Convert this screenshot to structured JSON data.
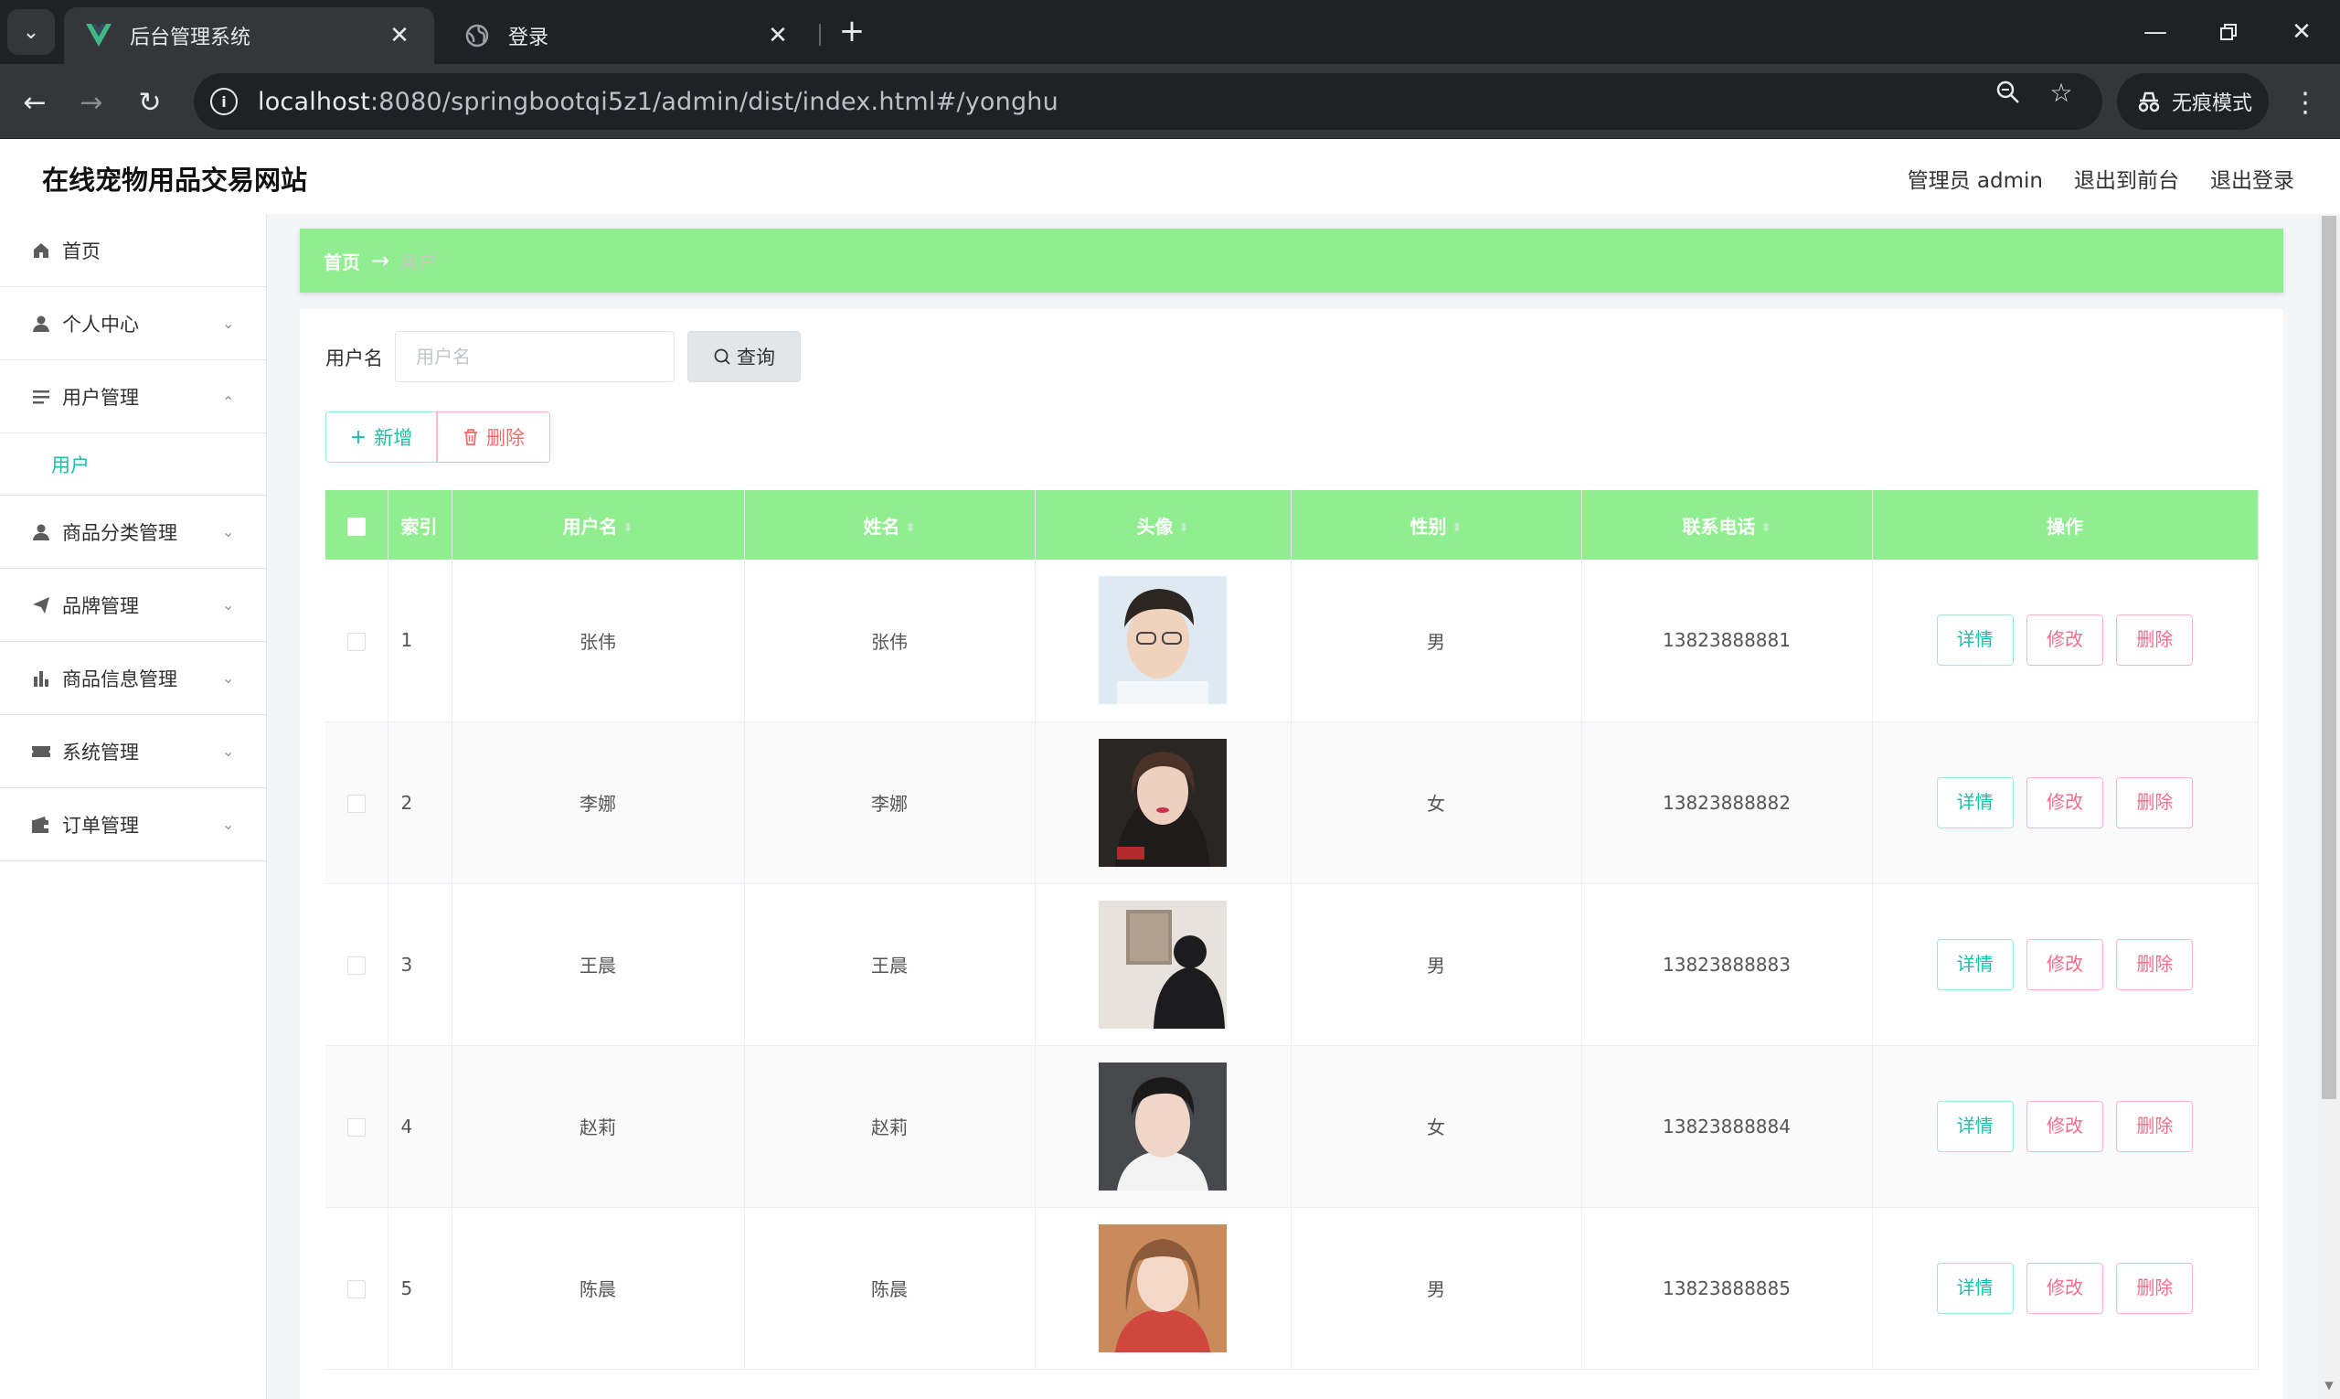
{
  "browser": {
    "tabs": [
      {
        "title": "后台管理系统",
        "active": true
      },
      {
        "title": "登录",
        "active": false
      }
    ],
    "url_host": "localhost",
    "url_path": ":8080/springbootqi5z1/admin/dist/index.html#/yonghu",
    "incognito_label": "无痕模式"
  },
  "header": {
    "title": "在线宠物用品交易网站",
    "user_label": "管理员 admin",
    "exit_front": "退出到前台",
    "logout": "退出登录"
  },
  "sidebar": {
    "items": [
      {
        "label": "首页",
        "icon": "home-icon"
      },
      {
        "label": "个人中心",
        "icon": "user-icon"
      },
      {
        "label": "用户管理",
        "icon": "list-icon"
      },
      {
        "label": "用户",
        "icon": ""
      },
      {
        "label": "商品分类管理",
        "icon": "user-icon"
      },
      {
        "label": "品牌管理",
        "icon": "send-icon"
      },
      {
        "label": "商品信息管理",
        "icon": "chart-icon"
      },
      {
        "label": "系统管理",
        "icon": "ticket-icon"
      },
      {
        "label": "订单管理",
        "icon": "wallet-icon"
      }
    ]
  },
  "breadcrumb": {
    "home": "首页",
    "separator": "→",
    "current": "用户"
  },
  "search": {
    "label": "用户名",
    "placeholder": "用户名",
    "value": "",
    "button": "查询"
  },
  "actions": {
    "add": "新增",
    "delete": "删除"
  },
  "table": {
    "columns": [
      "索引",
      "用户名",
      "姓名",
      "头像",
      "性别",
      "联系电话",
      "操作"
    ],
    "rows": [
      {
        "index": "1",
        "username": "张伟",
        "name": "张伟",
        "gender": "男",
        "phone": "13823888881"
      },
      {
        "index": "2",
        "username": "李娜",
        "name": "李娜",
        "gender": "女",
        "phone": "13823888882"
      },
      {
        "index": "3",
        "username": "王晨",
        "name": "王晨",
        "gender": "男",
        "phone": "13823888883"
      },
      {
        "index": "4",
        "username": "赵莉",
        "name": "赵莉",
        "gender": "女",
        "phone": "13823888884"
      },
      {
        "index": "5",
        "username": "陈晨",
        "name": "陈晨",
        "gender": "男",
        "phone": "13823888885"
      }
    ],
    "ops": {
      "detail": "详情",
      "edit": "修改",
      "delete": "删除"
    }
  },
  "colors": {
    "accent_green": "#90ee90",
    "teal": "#19c0a6",
    "danger": "#f56c6c",
    "chrome_dark": "#202124",
    "chrome_mid": "#35363a"
  }
}
